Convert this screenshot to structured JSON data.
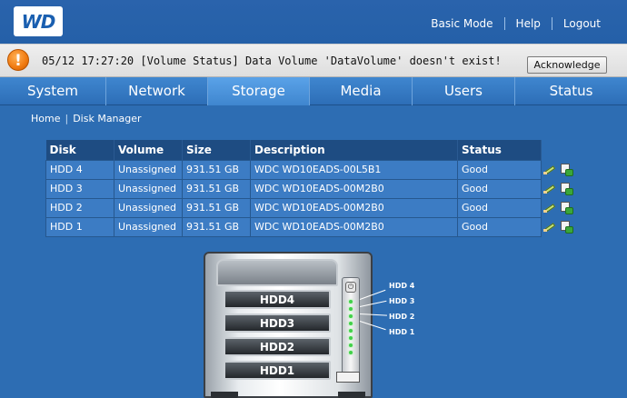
{
  "header": {
    "logo_text": "WD",
    "links": [
      "Basic Mode",
      "Help",
      "Logout"
    ]
  },
  "alert": {
    "icon": "exclamation-icon",
    "message": "05/12 17:27:20 [Volume Status] Data Volume 'DataVolume' doesn't exist!",
    "acknowledge_label": "Acknowledge"
  },
  "nav": {
    "tabs": [
      {
        "label": "System",
        "active": false
      },
      {
        "label": "Network",
        "active": false
      },
      {
        "label": "Storage",
        "active": true
      },
      {
        "label": "Media",
        "active": false
      },
      {
        "label": "Users",
        "active": false
      },
      {
        "label": "Status",
        "active": false
      }
    ]
  },
  "breadcrumb": {
    "home": "Home",
    "current": "Disk Manager"
  },
  "table": {
    "headers": [
      "Disk",
      "Volume",
      "Size",
      "Description",
      "Status"
    ],
    "rows": [
      {
        "disk": "HDD 4",
        "volume": "Unassigned",
        "size": "931.51 GB",
        "description": "WDC WD10EADS-00L5B1",
        "status": "Good"
      },
      {
        "disk": "HDD 3",
        "volume": "Unassigned",
        "size": "931.51 GB",
        "description": "WDC WD10EADS-00M2B0",
        "status": "Good"
      },
      {
        "disk": "HDD 2",
        "volume": "Unassigned",
        "size": "931.51 GB",
        "description": "WDC WD10EADS-00M2B0",
        "status": "Good"
      },
      {
        "disk": "HDD 1",
        "volume": "Unassigned",
        "size": "931.51 GB",
        "description": "WDC WD10EADS-00M2B0",
        "status": "Good"
      }
    ],
    "row_action_icons": [
      "edit-icon",
      "check-disk-icon"
    ]
  },
  "device": {
    "bays": [
      "HDD4",
      "HDD3",
      "HDD2",
      "HDD1"
    ],
    "led_labels": [
      "HDD 4",
      "HDD 3",
      "HDD 2",
      "HDD 1"
    ]
  },
  "colors": {
    "background": "#2d6db3",
    "nav_active": "#5aa2e8",
    "table_header": "#1e4c82",
    "table_row": "#3c7cc4",
    "alert_icon": "#f07a10"
  }
}
